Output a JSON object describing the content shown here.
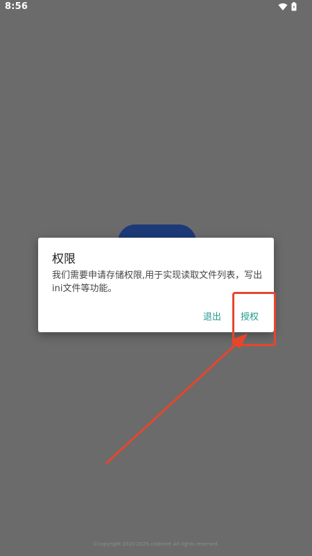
{
  "status_bar": {
    "time": "8:56",
    "icons": [
      "wifi-icon",
      "battery-icon"
    ]
  },
  "dialog": {
    "title": "权限",
    "message": "我们需要申请存储权限,用于实现读取文件列表，写出ini文件等功能。",
    "exit_label": "退出",
    "grant_label": "授权"
  },
  "footer": {
    "copyright": "©copyright 2020-2025 coldmint All rights reserved."
  },
  "colors": {
    "background": "#6b6b6b",
    "accent": "#1f9a8e",
    "annotation": "#e8452b",
    "splash": "#1c3a78"
  }
}
